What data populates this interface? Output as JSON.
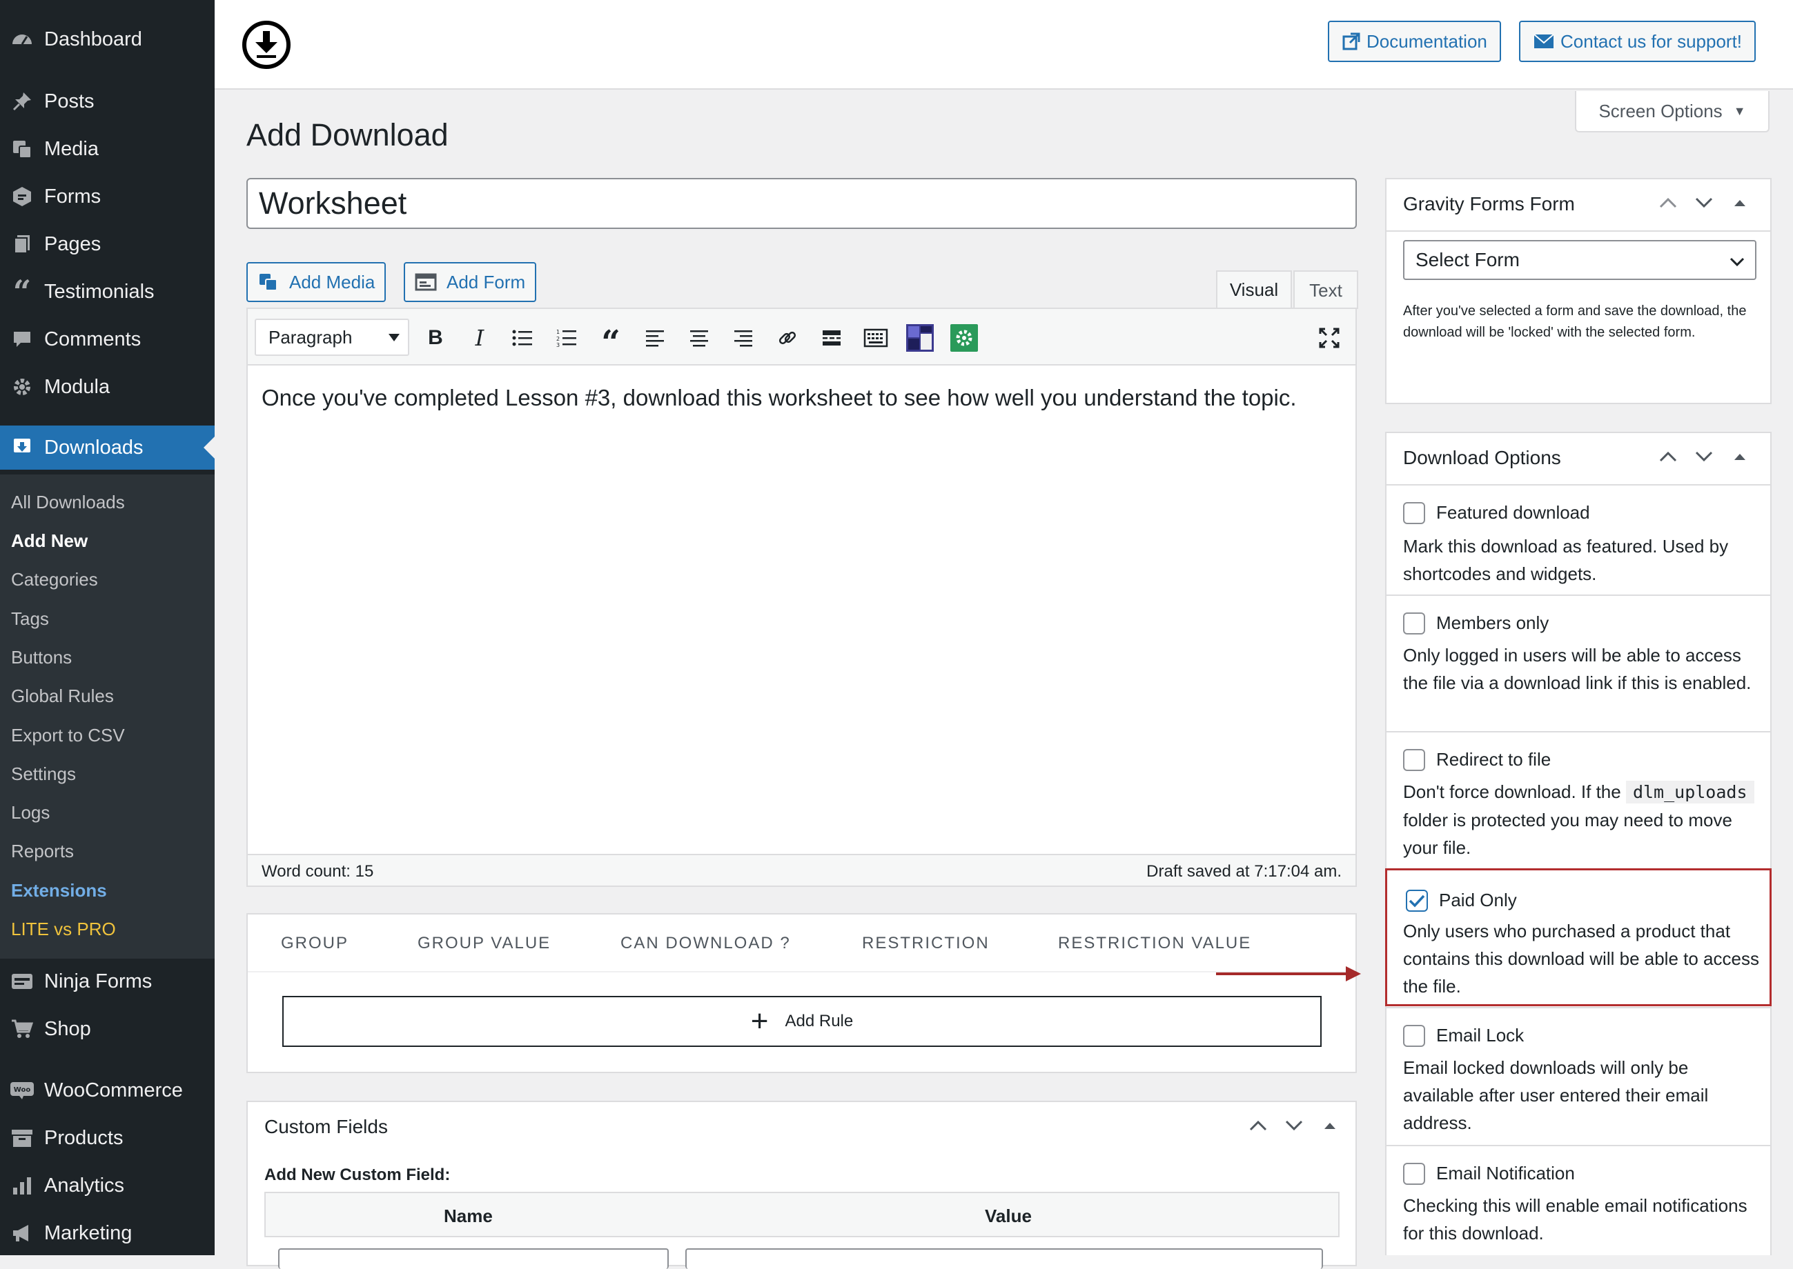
{
  "sidebar": {
    "menu": [
      {
        "label": "Dashboard",
        "icon": "dashboard-icon"
      },
      {
        "label": "Posts",
        "icon": "pin-icon"
      },
      {
        "label": "Media",
        "icon": "media-icon"
      },
      {
        "label": "Forms",
        "icon": "forms-icon"
      },
      {
        "label": "Pages",
        "icon": "pages-icon"
      },
      {
        "label": "Testimonials",
        "icon": "quote-icon"
      },
      {
        "label": "Comments",
        "icon": "comment-icon"
      },
      {
        "label": "Modula",
        "icon": "gear-icon"
      },
      {
        "label": "Downloads",
        "icon": "download-icon"
      },
      {
        "label": "Ninja Forms",
        "icon": "ninja-forms-icon"
      },
      {
        "label": "Shop",
        "icon": "cart-icon"
      },
      {
        "label": "WooCommerce",
        "icon": "woo-icon"
      },
      {
        "label": "Products",
        "icon": "archive-icon"
      },
      {
        "label": "Analytics",
        "icon": "chart-bar-icon"
      },
      {
        "label": "Marketing",
        "icon": "megaphone-icon"
      }
    ],
    "submenu": [
      "All Downloads",
      "Add New",
      "Categories",
      "Tags",
      "Buttons",
      "Global Rules",
      "Export to CSV",
      "Settings",
      "Logs",
      "Reports",
      "Extensions",
      "LITE vs PRO"
    ]
  },
  "header": {
    "documentation": "Documentation",
    "support": "Contact us for support!",
    "screen_options": "Screen Options"
  },
  "page": {
    "title": "Add Download",
    "post_title": "Worksheet"
  },
  "editor": {
    "add_media": "Add Media",
    "add_form": "Add Form",
    "tab_visual": "Visual",
    "tab_text": "Text",
    "format_select": "Paragraph",
    "content": "Once you've completed Lesson #3, download this worksheet to see how well you understand the topic.",
    "word_count": "Word count: 15",
    "draft_saved": "Draft saved at 7:17:04 am."
  },
  "rules": {
    "columns": [
      "GROUP",
      "GROUP VALUE",
      "CAN DOWNLOAD ?",
      "RESTRICTION",
      "RESTRICTION VALUE"
    ],
    "add_rule": "Add Rule"
  },
  "custom_fields": {
    "title": "Custom Fields",
    "subtitle": "Add New Custom Field:",
    "col_name": "Name",
    "col_value": "Value"
  },
  "gravity_forms": {
    "title": "Gravity Forms Form",
    "select": "Select Form",
    "help": "After you've selected a form and save the download, the download will be 'locked' with the selected form."
  },
  "download_options": {
    "title": "Download Options",
    "featured_label": "Featured download",
    "featured_desc": "Mark this download as featured. Used by shortcodes and widgets.",
    "members_label": "Members only",
    "members_desc": "Only logged in users will be able to access the file via a download link if this is enabled.",
    "redirect_label": "Redirect to file",
    "redirect_desc_1": "Don't force download. If the",
    "redirect_code": "dlm_uploads",
    "redirect_desc_2": "folder is protected you may need to move your file.",
    "paid_label": "Paid Only",
    "paid_checked": true,
    "paid_desc": "Only users who purchased a product that contains this download will be able to access the file.",
    "email_lock_label": "Email Lock",
    "email_lock_desc": "Email locked downloads will only be available after user entered their email address.",
    "email_notif_label": "Email Notification",
    "email_notif_desc": "Checking this will enable email notifications for this download."
  },
  "colors": {
    "admin_bar": "#1d2327",
    "accent": "#2271b1",
    "highlight_border": "#b32d2e",
    "extensions_link": "#72aee6",
    "lite_link": "#f0c33c"
  }
}
